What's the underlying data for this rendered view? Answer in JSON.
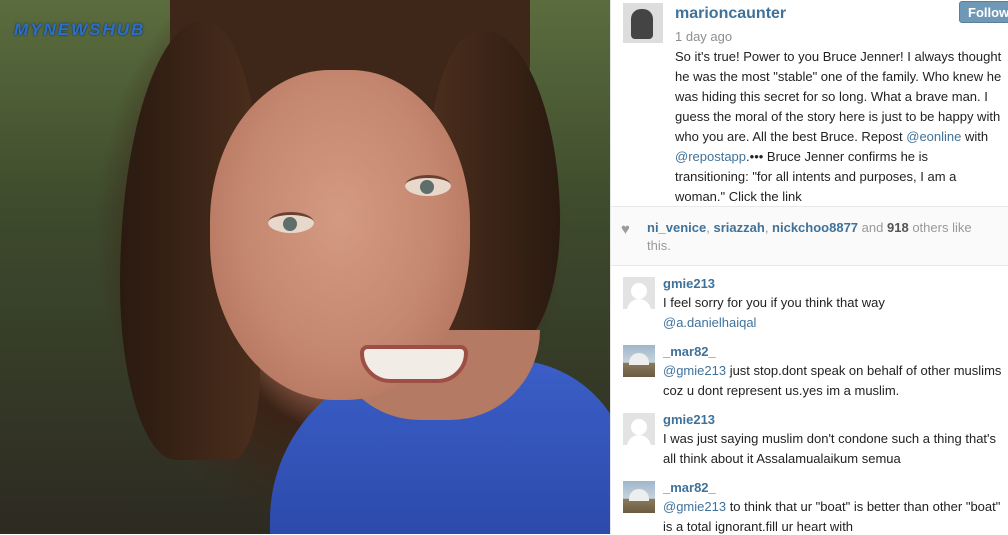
{
  "photo": {
    "logo_text": "MYNEWSHUB"
  },
  "post": {
    "username": "marioncaunter",
    "time": "1 day ago",
    "follow_label": "Follow",
    "caption_start": "So it's true! Power to you Bruce Jenner! I always thought he was the most \"stable\" one of the family. Who knew he was hiding this secret for so long. What a brave man. I guess the moral of the story here is just to be happy with who you are. All the best Bruce. Repost ",
    "caption_mention1": "@eonline",
    "caption_with": " with ",
    "caption_mention2": "@repostapp",
    "caption_end": ".••• Bruce Jenner confirms he is transitioning: \"for all intents and purposes, I am a woman.\" Click the link"
  },
  "likes": {
    "user1": "ni_venice",
    "user2": "sriazzah",
    "user3": "nickchoo8877",
    "and": "and",
    "count": "918",
    "others": "others like this."
  },
  "comments": [
    {
      "user": "gmie213",
      "text": "I feel sorry for you if you think that way",
      "mention": "@a.danielhaiqal",
      "after": ""
    },
    {
      "user": "_mar82_",
      "mention": "@gmie213",
      "text": " just stop.dont speak on behalf of other muslims coz u dont represent us.yes im a muslim."
    },
    {
      "user": "gmie213",
      "text": "I was just saying muslim don't condone such a thing that's all think about it Assalamualaikum semua"
    },
    {
      "user": "_mar82_",
      "mention": "@gmie213",
      "text": " to think that ur \"boat\" is better than other \"boat\" is a total ignorant.fill ur heart with"
    }
  ],
  "colors": {
    "link": "#3f729b",
    "follow_bg": "#6f97b6",
    "logo": "#2d6fc6"
  },
  "icons": {
    "heart": "heart-icon"
  }
}
